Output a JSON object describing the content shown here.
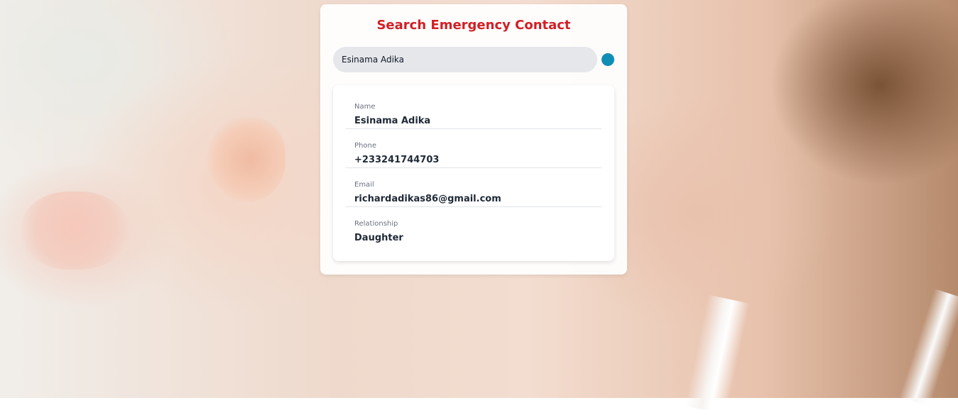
{
  "page": {
    "title": "Search Emergency Contact"
  },
  "search": {
    "value": "Esinama Adika",
    "status_color": "#0f8db5"
  },
  "contact": {
    "fields": [
      {
        "label": "Name",
        "value": "Esinama Adika"
      },
      {
        "label": "Phone",
        "value": "+233241744703"
      },
      {
        "label": "Email",
        "value": "richardadikas86@gmail.com"
      },
      {
        "label": "Relationship",
        "value": "Daughter"
      }
    ]
  },
  "colors": {
    "title": "#d21f26",
    "input_bg": "#e5e7eb",
    "card_bg": "#ffffff"
  }
}
